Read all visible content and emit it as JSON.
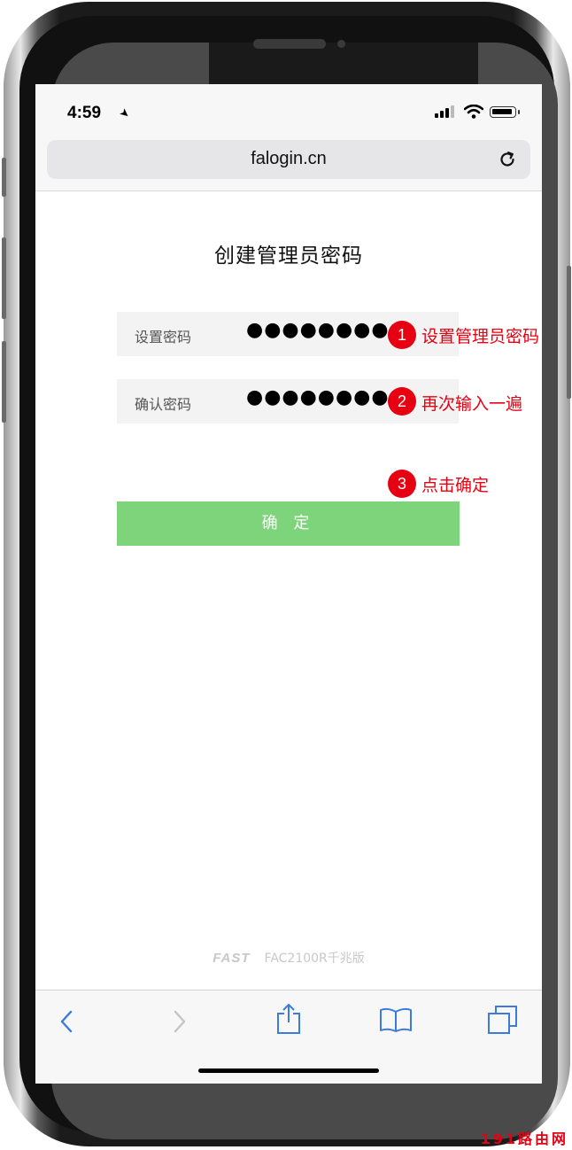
{
  "status_bar": {
    "time": "4:59"
  },
  "browser": {
    "url": "falogin.cn"
  },
  "page": {
    "title": "创建管理员密码",
    "fields": [
      {
        "label": "设置密码",
        "value": "●●●●●●●●●"
      },
      {
        "label": "确认密码",
        "value": "●●●●●●●●●"
      }
    ],
    "confirm_label": "确 定",
    "footer_brand": "FAST",
    "footer_model": "FAC2100R千兆版"
  },
  "annotations": [
    {
      "number": "1",
      "text": "设置管理员密码"
    },
    {
      "number": "2",
      "text": "再次输入一遍"
    },
    {
      "number": "3",
      "text": "点击确定"
    }
  ],
  "watermark": "191路由网",
  "colors": {
    "accent_red": "#e60012",
    "button_green": "#7dd47b",
    "toolbar_blue": "#3b7bde"
  },
  "icons": [
    "location-arrow-icon",
    "signal-icon",
    "wifi-icon",
    "battery-icon",
    "reload-icon",
    "back-icon",
    "forward-icon",
    "share-icon",
    "bookmarks-icon",
    "tabs-icon"
  ]
}
